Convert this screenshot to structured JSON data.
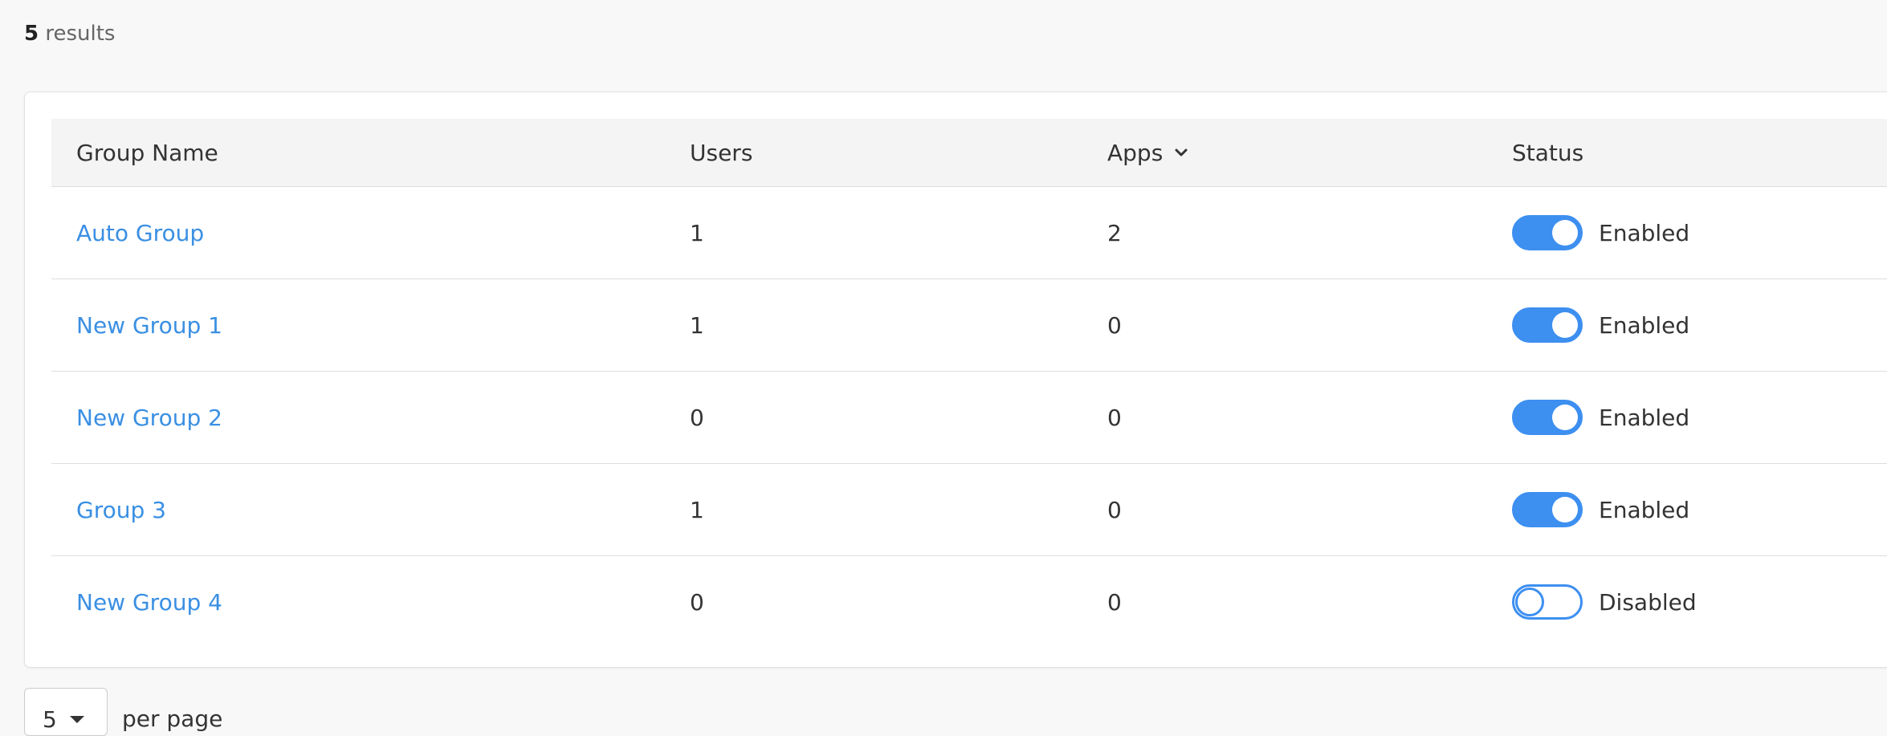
{
  "summary": {
    "count": "5",
    "label": "results"
  },
  "table": {
    "headers": {
      "name": "Group Name",
      "users": "Users",
      "apps": "Apps",
      "status": "Status"
    },
    "sort": {
      "column": "Apps",
      "icon": "chevron-down-icon"
    },
    "rows": [
      {
        "name": "Auto Group",
        "users": "1",
        "apps": "2",
        "enabled": true,
        "status": "Enabled"
      },
      {
        "name": "New Group 1",
        "users": "1",
        "apps": "0",
        "enabled": true,
        "status": "Enabled"
      },
      {
        "name": "New Group 2",
        "users": "0",
        "apps": "0",
        "enabled": true,
        "status": "Enabled"
      },
      {
        "name": "Group 3",
        "users": "1",
        "apps": "0",
        "enabled": true,
        "status": "Enabled"
      },
      {
        "name": "New Group 4",
        "users": "0",
        "apps": "0",
        "enabled": false,
        "status": "Disabled"
      }
    ]
  },
  "pagination": {
    "per_page_value": "5",
    "per_page_label": "per page"
  },
  "colors": {
    "link": "#3a8fe3",
    "toggle_accent": "#3d8ff0",
    "header_bg": "#f4f4f4"
  }
}
